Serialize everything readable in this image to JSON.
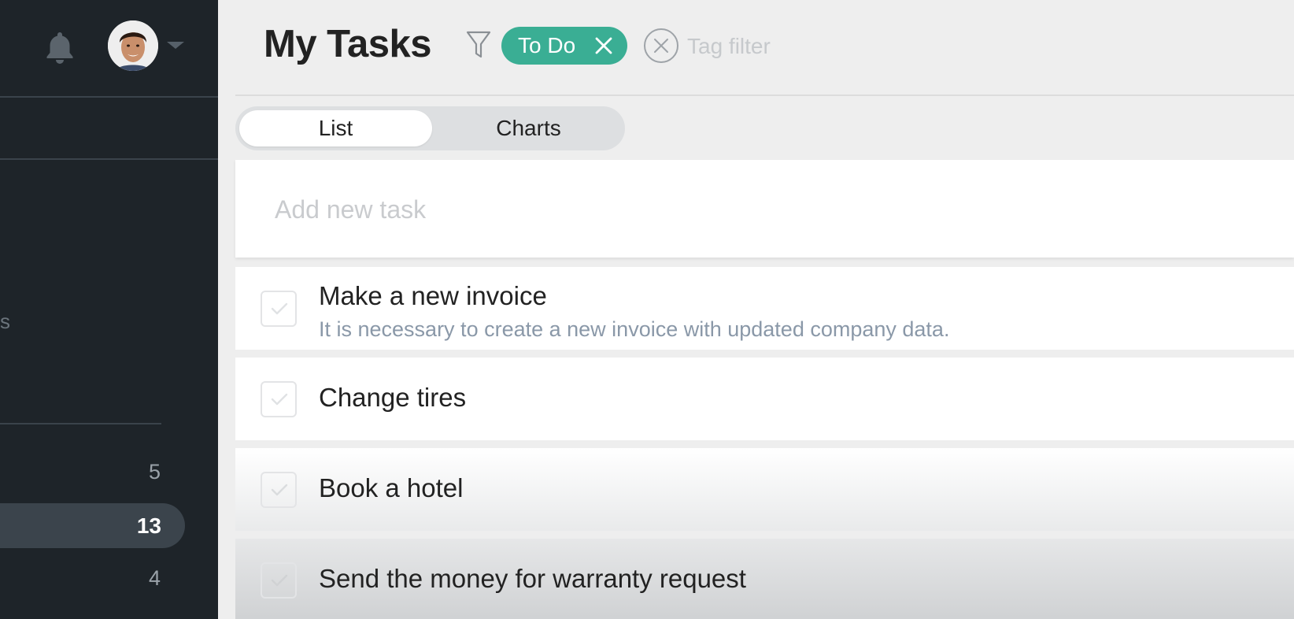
{
  "sidebar": {
    "bell_icon": "bell-icon",
    "avatar_icon": "avatar",
    "partial_label": "s",
    "counts": [
      "5",
      "13",
      "4"
    ]
  },
  "header": {
    "title": "My Tasks",
    "filter_icon": "filter-icon",
    "tag_chip": "To Do",
    "tag_filter_placeholder": "Tag filter"
  },
  "view_toggle": {
    "list": "List",
    "charts": "Charts",
    "active": "List"
  },
  "new_task": {
    "placeholder": "Add new task"
  },
  "tasks": [
    {
      "title": "Make a new invoice",
      "description": "It is necessary to create a new invoice with updated company data."
    },
    {
      "title": "Change tires",
      "description": ""
    },
    {
      "title": "Book a hotel",
      "description": ""
    },
    {
      "title": "Send the money for warranty request",
      "description": ""
    }
  ],
  "colors": {
    "sidebar_bg": "#1e2429",
    "accent": "#3aae94",
    "background": "#eeeeee"
  }
}
